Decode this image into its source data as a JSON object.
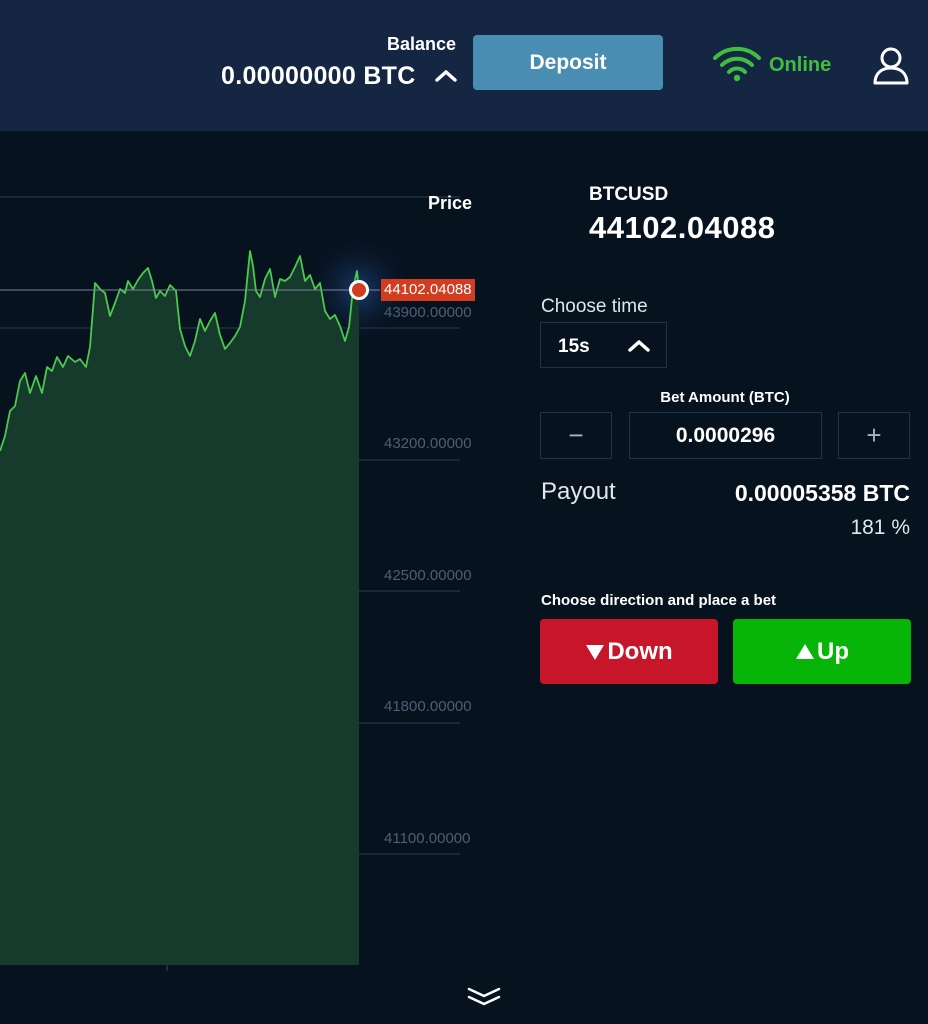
{
  "header": {
    "balance_label": "Balance",
    "balance_value": "0.00000000 BTC",
    "balance_toggle_icon": "chevron-up-icon",
    "deposit_label": "Deposit",
    "connection_status": "Online",
    "connection_icon": "wifi-icon",
    "user_icon": "user-icon",
    "colors": {
      "header_bg": "#142642",
      "deposit_bg": "#4a8db3",
      "online": "#3fbf3f"
    }
  },
  "chart": {
    "heading": "Price",
    "current_price_tag": "44102.04088",
    "price_ticks": [
      "43900.00000",
      "43200.00000",
      "42500.00000",
      "41800.00000",
      "41100.00000"
    ],
    "scroll_icon": "double-chevron-down-icon",
    "colors": {
      "line": "#4cc94c",
      "fill": "#163a2c",
      "marker": "#d23c1f"
    }
  },
  "trade": {
    "symbol": "BTCUSD",
    "symbol_price": "44102.04088",
    "choose_time_label": "Choose time",
    "time_value": "15s",
    "bet_amount_label": "Bet Amount (BTC)",
    "bet_decrement": "−",
    "bet_amount_value": "0.0000296",
    "bet_increment": "+",
    "payout_label": "Payout",
    "payout_value": "0.00005358 BTC",
    "payout_percent": "181 %",
    "direction_label": "Choose direction and place a bet",
    "down_label": "Down",
    "up_label": "Up",
    "colors": {
      "down": "#c7152a",
      "up": "#06b507"
    }
  }
}
